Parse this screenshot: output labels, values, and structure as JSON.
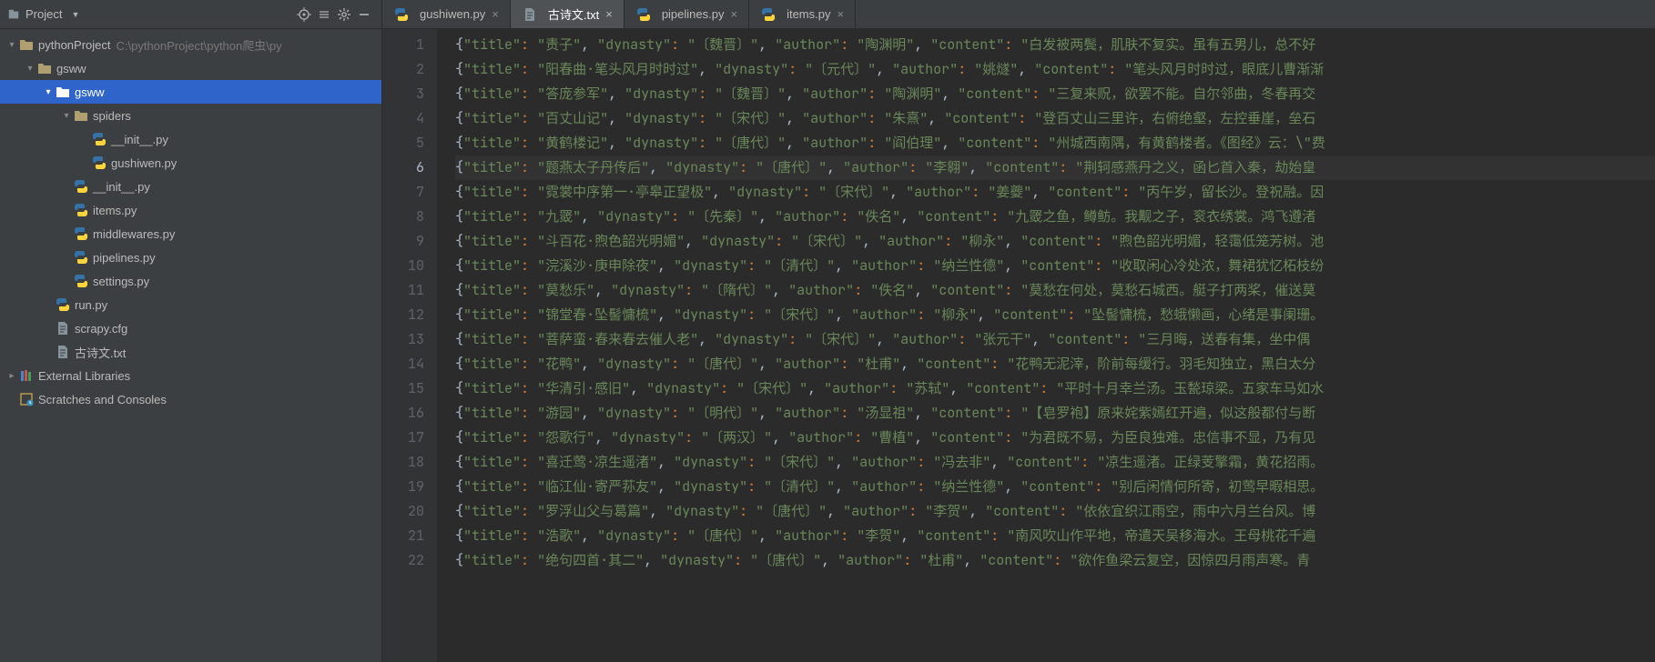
{
  "sidebar": {
    "title": "Project",
    "root": {
      "name": "pythonProject",
      "path": "C:\\pythonProject\\python爬虫\\py"
    },
    "tree": [
      {
        "depth": 0,
        "expand": "v",
        "icon": "dir",
        "label": "pythonProject",
        "extra": "C:\\pythonProject\\python爬虫\\py"
      },
      {
        "depth": 1,
        "expand": "v",
        "icon": "dir",
        "label": "gsww"
      },
      {
        "depth": 2,
        "expand": "v",
        "icon": "dir",
        "label": "gsww",
        "sel": true
      },
      {
        "depth": 3,
        "expand": "v",
        "icon": "dir",
        "label": "spiders"
      },
      {
        "depth": 4,
        "expand": "",
        "icon": "py",
        "label": "__init__.py"
      },
      {
        "depth": 4,
        "expand": "",
        "icon": "py",
        "label": "gushiwen.py"
      },
      {
        "depth": 3,
        "expand": "",
        "icon": "py",
        "label": "__init__.py"
      },
      {
        "depth": 3,
        "expand": "",
        "icon": "py",
        "label": "items.py"
      },
      {
        "depth": 3,
        "expand": "",
        "icon": "py",
        "label": "middlewares.py"
      },
      {
        "depth": 3,
        "expand": "",
        "icon": "py",
        "label": "pipelines.py"
      },
      {
        "depth": 3,
        "expand": "",
        "icon": "py",
        "label": "settings.py"
      },
      {
        "depth": 2,
        "expand": "",
        "icon": "py",
        "label": "run.py"
      },
      {
        "depth": 2,
        "expand": "",
        "icon": "txt",
        "label": "scrapy.cfg"
      },
      {
        "depth": 2,
        "expand": "",
        "icon": "txt",
        "label": "古诗文.txt"
      },
      {
        "depth": 0,
        "expand": ">",
        "icon": "lib",
        "label": "External Libraries"
      },
      {
        "depth": 0,
        "expand": "",
        "icon": "scr",
        "label": "Scratches and Consoles"
      }
    ]
  },
  "tabs": [
    {
      "icon": "py",
      "label": "gushiwen.py",
      "active": false
    },
    {
      "icon": "txt",
      "label": "古诗文.txt",
      "active": true
    },
    {
      "icon": "py",
      "label": "pipelines.py",
      "active": false
    },
    {
      "icon": "py",
      "label": "items.py",
      "active": false
    }
  ],
  "editor": {
    "active_line": 6,
    "lines": [
      {
        "n": 1,
        "title": "责子",
        "dynasty": "〔魏晋〕",
        "author": "陶渊明",
        "content": "白发被两鬓，肌肤不复实。虽有五男儿，总不好"
      },
      {
        "n": 2,
        "title": "阳春曲·笔头风月时时过",
        "dynasty": "〔元代〕",
        "author": "姚燧",
        "content": "笔头风月时时过，眼底儿曹渐渐"
      },
      {
        "n": 3,
        "title": "答庞参军",
        "dynasty": "〔魏晋〕",
        "author": "陶渊明",
        "content": "三复来贶，欲罢不能。自尔邻曲，冬春再交"
      },
      {
        "n": 4,
        "title": "百丈山记",
        "dynasty": "〔宋代〕",
        "author": "朱熹",
        "content": "登百丈山三里许，右俯绝壑，左控垂崖，垒石"
      },
      {
        "n": 5,
        "title": "黄鹤楼记",
        "dynasty": "〔唐代〕",
        "author": "阎伯理",
        "content": "州城西南隅，有黄鹤楼者。《图经》云：\"费"
      },
      {
        "n": 6,
        "title": "题燕太子丹传后",
        "dynasty": "〔唐代〕",
        "author": "李翱",
        "content": "荆轲感燕丹之义，函匕首入秦，劫始皇"
      },
      {
        "n": 7,
        "title": "霓裳中序第一·亭皋正望极",
        "dynasty": "〔宋代〕",
        "author": "姜夔",
        "content": "丙午岁，留长沙。登祝融。因"
      },
      {
        "n": 8,
        "title": "九罭",
        "dynasty": "〔先秦〕",
        "author": "佚名",
        "content": "九罭之鱼，鳟鲂。我觏之子，衮衣绣裳。鸿飞遵渚"
      },
      {
        "n": 9,
        "title": "斗百花·煦色韶光明媚",
        "dynasty": "〔宋代〕",
        "author": "柳永",
        "content": "煦色韶光明媚，轻霭低笼芳树。池"
      },
      {
        "n": 10,
        "title": "浣溪沙·庚申除夜",
        "dynasty": "〔清代〕",
        "author": "纳兰性德",
        "content": "收取闲心冷处浓，舞裙犹忆柘枝纷"
      },
      {
        "n": 11,
        "title": "莫愁乐",
        "dynasty": "〔隋代〕",
        "author": "佚名",
        "content": "莫愁在何处，莫愁石城西。艇子打两桨，催送莫"
      },
      {
        "n": 12,
        "title": "锦堂春·坠髻慵梳",
        "dynasty": "〔宋代〕",
        "author": "柳永",
        "content": "坠髻慵梳，愁蛾懒画，心绪是事阑珊。"
      },
      {
        "n": 13,
        "title": "菩萨蛮·春来春去催人老",
        "dynasty": "〔宋代〕",
        "author": "张元干",
        "content": "三月晦，送春有集，坐中偶"
      },
      {
        "n": 14,
        "title": "花鸭",
        "dynasty": "〔唐代〕",
        "author": "杜甫",
        "content": "花鸭无泥滓，阶前每缓行。羽毛知独立，黑白太分"
      },
      {
        "n": 15,
        "title": "华清引·感旧",
        "dynasty": "〔宋代〕",
        "author": "苏轼",
        "content": "平时十月幸兰汤。玉甃琼梁。五家车马如水"
      },
      {
        "n": 16,
        "title": "游园",
        "dynasty": "〔明代〕",
        "author": "汤显祖",
        "content": "【皂罗袍】原来姹紫嫣红开遍，似这般都付与断"
      },
      {
        "n": 17,
        "title": "怨歌行",
        "dynasty": "〔两汉〕",
        "author": "曹植",
        "content": "为君既不易，为臣良独难。忠信事不显，乃有见"
      },
      {
        "n": 18,
        "title": "喜迁莺·凉生遥渚",
        "dynasty": "〔宋代〕",
        "author": "冯去非",
        "content": "凉生遥渚。正绿芰擎霜，黄花招雨。"
      },
      {
        "n": 19,
        "title": "临江仙·寄严荪友",
        "dynasty": "〔清代〕",
        "author": "纳兰性德",
        "content": "别后闲情何所寄，初莺早暇相思。"
      },
      {
        "n": 20,
        "title": "罗浮山父与葛篇",
        "dynasty": "〔唐代〕",
        "author": "李贺",
        "content": "依依宜织江雨空，雨中六月兰台风。博"
      },
      {
        "n": 21,
        "title": "浩歌",
        "dynasty": "〔唐代〕",
        "author": "李贺",
        "content": "南风吹山作平地，帝遣天吴移海水。王母桃花千遍"
      },
      {
        "n": 22,
        "title": "绝句四首·其二",
        "dynasty": "〔唐代〕",
        "author": "杜甫",
        "content": "欲作鱼梁云复空，因惊四月雨声寒。青"
      }
    ]
  }
}
